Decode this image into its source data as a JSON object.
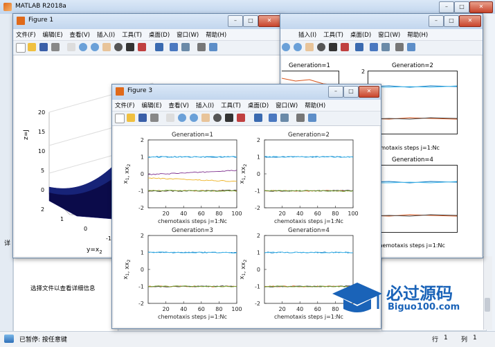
{
  "app": {
    "title": "MATLAB R2018a",
    "detail_hint": "选择文件以查看详细信息",
    "status_paused": "已暂停: 按任意键",
    "row_label": "行",
    "row_value": "1",
    "col_label": "列",
    "col_value": "1",
    "tab_fragment": "详"
  },
  "menu": [
    "文件(F)",
    "编辑(E)",
    "查看(V)",
    "插入(I)",
    "工具(T)",
    "桌面(D)",
    "窗口(W)",
    "帮助(H)"
  ],
  "figure1": {
    "title": "Figure 1",
    "zlabel": "z=J",
    "ylabel": "y=x",
    "ylabel_sub": "2",
    "zticks": [
      "20",
      "15",
      "10",
      "5",
      "0"
    ],
    "yticks": [
      "2",
      "1",
      "0",
      "-1"
    ]
  },
  "figure_back": {
    "panel1_title": "Generation=1",
    "panel2_title": "Generation=2",
    "panel4_title": "Generation=4",
    "xlabel": "chemotaxis steps j=1:Nc",
    "yticks_top": [
      "2",
      "1"
    ]
  },
  "figure3": {
    "title": "Figure 3",
    "xlabel": "chemotaxis steps j=1:Nc",
    "ylabel_main": "x",
    "ylabel_sub1": "1",
    "ylabel_mid": ", x",
    "ylabel_sub2": "2",
    "xticks": [
      "20",
      "40",
      "60",
      "80",
      "100"
    ],
    "yticks": [
      "2",
      "1",
      "0",
      "-1",
      "-2"
    ]
  },
  "watermark": {
    "brand": "必过源码",
    "site": "Biguo100.com"
  },
  "chart_data": {
    "type": "line",
    "panels": [
      {
        "title": "Generation=1",
        "xlabel": "chemotaxis steps j=1:Nc",
        "ylim": [
          -2,
          2
        ],
        "xlim": [
          0,
          100
        ],
        "series": [
          {
            "color": "#0072bd",
            "y0": 1.0,
            "y1": 1.0
          },
          {
            "color": "#4dbeee",
            "y0": 0.98,
            "y1": 1.02
          },
          {
            "color": "#7e2f8e",
            "y0": -0.05,
            "y1": 0.2
          },
          {
            "color": "#edb120",
            "y0": -0.25,
            "y1": -0.45
          },
          {
            "color": "#d95319",
            "y0": -1.0,
            "y1": -1.0
          },
          {
            "color": "#444444",
            "y0": -1.02,
            "y1": -0.98
          },
          {
            "color": "#77ac30",
            "y0": -0.98,
            "y1": -1.02
          }
        ]
      },
      {
        "title": "Generation=2",
        "xlabel": "chemotaxis steps j=1:Nc",
        "ylim": [
          -2,
          2
        ],
        "xlim": [
          0,
          100
        ],
        "series": [
          {
            "color": "#0072bd",
            "y0": 1.0,
            "y1": 1.0
          },
          {
            "color": "#4dbeee",
            "y0": 1.01,
            "y1": 0.99
          },
          {
            "color": "#d95319",
            "y0": -1.0,
            "y1": -1.0
          },
          {
            "color": "#444444",
            "y0": -1.01,
            "y1": -0.99
          },
          {
            "color": "#77ac30",
            "y0": -0.99,
            "y1": -1.01
          }
        ]
      },
      {
        "title": "Generation=3",
        "xlabel": "chemotaxis steps j=1:Nc",
        "ylim": [
          -2,
          2
        ],
        "xlim": [
          0,
          100
        ],
        "series": [
          {
            "color": "#0072bd",
            "y0": 1.0,
            "y1": 1.0
          },
          {
            "color": "#4dbeee",
            "y0": 1.01,
            "y1": 0.99
          },
          {
            "color": "#d95319",
            "y0": -1.0,
            "y1": -1.0
          },
          {
            "color": "#444444",
            "y0": -1.01,
            "y1": -0.99
          },
          {
            "color": "#77ac30",
            "y0": -0.99,
            "y1": -1.01
          }
        ]
      },
      {
        "title": "Generation=4",
        "xlabel": "chemotaxis steps j=1:Nc",
        "ylim": [
          -2,
          2
        ],
        "xlim": [
          0,
          100
        ],
        "series": [
          {
            "color": "#0072bd",
            "y0": 1.0,
            "y1": 1.0
          },
          {
            "color": "#4dbeee",
            "y0": 1.01,
            "y1": 0.99
          },
          {
            "color": "#d95319",
            "y0": -1.0,
            "y1": -1.0
          },
          {
            "color": "#444444",
            "y0": -1.01,
            "y1": -0.99
          },
          {
            "color": "#77ac30",
            "y0": -0.99,
            "y1": -1.01
          }
        ]
      }
    ]
  }
}
